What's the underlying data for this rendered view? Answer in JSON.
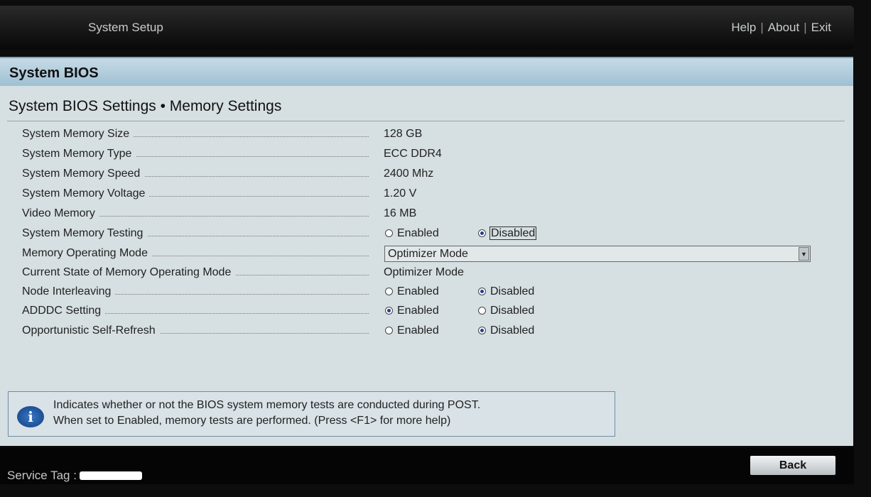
{
  "header": {
    "title": "System Setup",
    "links": [
      "Help",
      "About",
      "Exit"
    ]
  },
  "page": {
    "section": "System BIOS",
    "subtitle": "System BIOS Settings • Memory Settings"
  },
  "rows": [
    {
      "label": "System Memory Size",
      "value": "128 GB"
    },
    {
      "label": "System Memory Type",
      "value": "ECC DDR4"
    },
    {
      "label": "System Memory Speed",
      "value": "2400 Mhz"
    },
    {
      "label": "System Memory Voltage",
      "value": "1.20 V"
    },
    {
      "label": "Video Memory",
      "value": "16 MB"
    },
    {
      "label": "System Memory Testing",
      "options": [
        "Enabled",
        "Disabled"
      ],
      "selected": "Disabled"
    },
    {
      "label": "Memory Operating Mode",
      "value": "Optimizer Mode"
    },
    {
      "label": "Current State of Memory Operating Mode",
      "value": "Optimizer Mode"
    },
    {
      "label": "Node Interleaving",
      "options": [
        "Enabled",
        "Disabled"
      ],
      "selected": "Disabled"
    },
    {
      "label": "ADDDC Setting",
      "options": [
        "Enabled",
        "Disabled"
      ],
      "selected": "Enabled"
    },
    {
      "label": "Opportunistic Self-Refresh",
      "options": [
        "Enabled",
        "Disabled"
      ],
      "selected": "Disabled"
    }
  ],
  "help": {
    "line1": "Indicates whether or not the BIOS system memory tests are conducted during POST.",
    "line2": "When set to Enabled, memory tests are performed. (Press <F1> for more help)"
  },
  "footer": {
    "service_tag_label": "Service Tag :",
    "back_label": "Back"
  },
  "colors": {
    "radio_selected": "#1c3f91",
    "header_band": "#9fc0d3"
  }
}
